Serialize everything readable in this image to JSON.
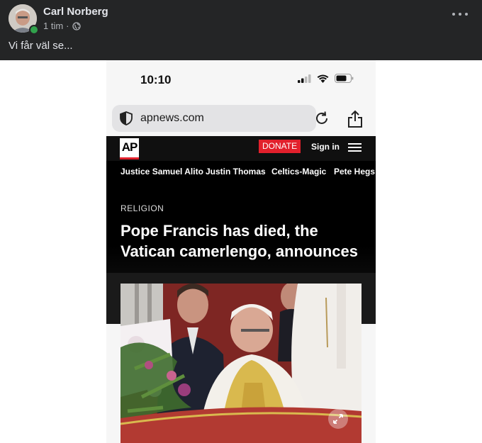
{
  "post": {
    "author": "Carl Norberg",
    "time": "1 tim",
    "separator": "·",
    "privacy_icon": "globe-icon",
    "text": "Vi får väl se..."
  },
  "phone": {
    "status_time": "10:10",
    "url": "apnews.com",
    "ap": {
      "logo": "AP",
      "donate": "DONATE",
      "sign_in": "Sign in",
      "topics": [
        "Justice Samuel Alito",
        "Justin Thomas",
        "Celtics-Magic",
        "Pete Hegs"
      ],
      "kicker": "RELIGION",
      "headline": "Pope Francis has died, the Vatican camerlengo, announces"
    }
  },
  "colors": {
    "fb_background": "#242526",
    "ap_red": "#e2202c",
    "online_green": "#31a24c"
  }
}
